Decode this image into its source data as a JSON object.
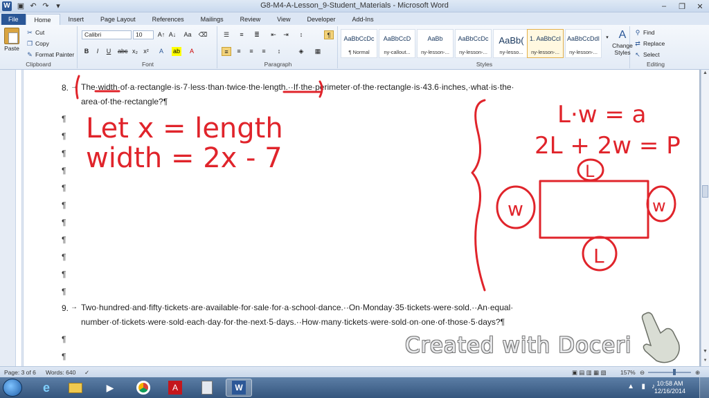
{
  "titlebar": {
    "title": "G8-M4-A-Lesson_9-Student_Materials - Microsoft Word",
    "minimize": "–",
    "restore": "❐",
    "close": "✕"
  },
  "tabs": [
    "File",
    "Home",
    "Insert",
    "Page Layout",
    "References",
    "Mailings",
    "Review",
    "View",
    "Developer",
    "Add-Ins"
  ],
  "ribbon": {
    "clipboard": {
      "paste": "Paste",
      "cut": "Cut",
      "copy": "Copy",
      "format_painter": "Format Painter",
      "label": "Clipboard"
    },
    "font": {
      "family": "Calibri",
      "size": "10",
      "label": "Font"
    },
    "paragraph": {
      "label": "Paragraph"
    },
    "styles": {
      "label": "Styles",
      "items": [
        {
          "sample": "AaBbCcDc",
          "name": "¶ Normal"
        },
        {
          "sample": "AaBbCcD",
          "name": "ny-callout..."
        },
        {
          "sample": "AaBb",
          "name": "ny-lesson-..."
        },
        {
          "sample": "AaBbCcDc",
          "name": "ny-lesson-..."
        },
        {
          "sample": "AaBb(",
          "name": "ny-lesso..."
        },
        {
          "sample": "1. AaBbCcI",
          "name": "ny-lesson-..."
        },
        {
          "sample": "AaBbCcDdI",
          "name": "ny-lesson-..."
        }
      ],
      "change_styles": "Change Styles"
    },
    "editing": {
      "find": "Find",
      "replace": "Replace",
      "select": "Select",
      "label": "Editing"
    }
  },
  "document": {
    "q8_line1_num": "8.",
    "q8_line1": "The·width·of·a·rectangle·is·7·less·than·twice·the·length.··If·the·perimeter·of·the·rectangle·is·43.6·inches,·what·is·the·",
    "q8_line2": "area·of·the·rectangle?¶",
    "q9_num": "9.",
    "q9_line1": "Two·hundred·and·fifty·tickets·are·available·for·sale·for·a·school·dance.··On·Monday·35·tickets·were·sold.··An·equal·",
    "q9_line2": "number·of·tickets·were·sold·each·day·for·the·next·5·days.··How·many·tickets·were·sold·on·one·of·those·5·days?¶",
    "pilcrow": "¶"
  },
  "handwriting": {
    "let": "Let x = length",
    "width": "width = 2x - 7",
    "area_formula": "L·w = a",
    "perimeter_formula": "2L + 2w = P",
    "top_label": "L",
    "bottom_label": "L",
    "left_label": "w",
    "right_label": "w"
  },
  "watermark": "Created with Doceri",
  "statusbar": {
    "page": "Page: 3 of 6",
    "words": "Words: 640",
    "zoom": "157%"
  },
  "taskbar": {
    "time": "10:58 AM",
    "date": "12/16/2014"
  },
  "colors": {
    "ink": "#e0242b",
    "word_blue": "#2b5797"
  }
}
